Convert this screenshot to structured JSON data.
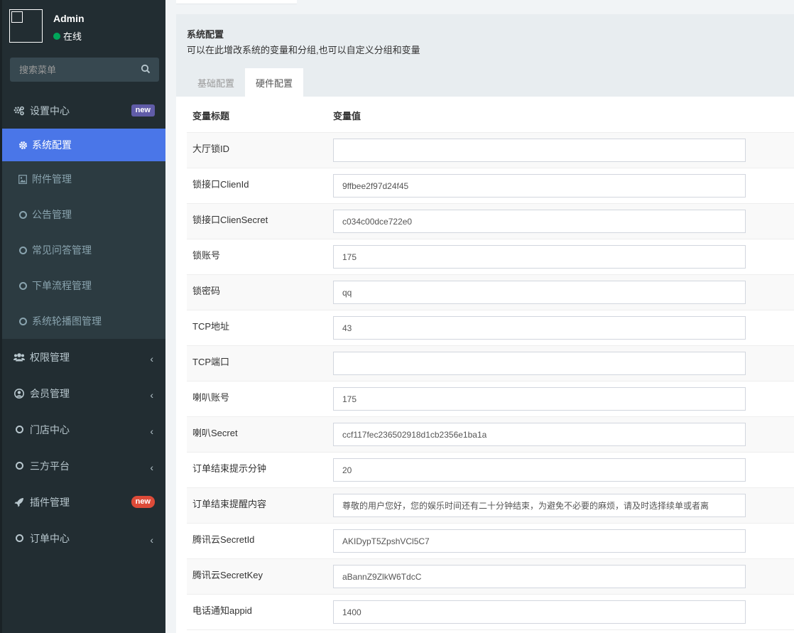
{
  "user": {
    "name": "Admin",
    "status": "在线"
  },
  "search": {
    "placeholder": "搜索菜单"
  },
  "menu": {
    "settings": {
      "label": "设置中心",
      "badge": "new"
    },
    "sub": [
      {
        "label": "系统配置",
        "icon": "gear-icon"
      },
      {
        "label": "附件管理",
        "icon": "image-icon"
      },
      {
        "label": "公告管理",
        "icon": "circle-icon"
      },
      {
        "label": "常见问答管理",
        "icon": "circle-icon"
      },
      {
        "label": "下单流程管理",
        "icon": "circle-icon"
      },
      {
        "label": "系统轮播图管理",
        "icon": "circle-icon"
      }
    ],
    "items": [
      {
        "label": "权限管理",
        "icon": "users-icon"
      },
      {
        "label": "会员管理",
        "icon": "user-circle-icon"
      },
      {
        "label": "门店中心",
        "icon": "circle-icon"
      },
      {
        "label": "三方平台",
        "icon": "circle-icon"
      },
      {
        "label": "插件管理",
        "icon": "rocket-icon",
        "badge": "new"
      },
      {
        "label": "订单中心",
        "icon": "circle-icon"
      }
    ]
  },
  "panel": {
    "title": "系统配置",
    "description": "可以在此增改系统的变量和分组,也可以自定义分组和变量",
    "tabs": [
      "基础配置",
      "硬件配置"
    ]
  },
  "table": {
    "headers": [
      "变量标题",
      "变量值"
    ],
    "rows": [
      {
        "label": "大厅锁ID",
        "value": ""
      },
      {
        "label": "锁接口ClienId",
        "value": "9ffbee2f97d24f45"
      },
      {
        "label": "锁接口ClienSecret",
        "value": "c034c00dce722e0"
      },
      {
        "label": "锁账号",
        "value": "175"
      },
      {
        "label": "锁密码",
        "value": "qq"
      },
      {
        "label": "TCP地址",
        "value": "43"
      },
      {
        "label": "TCP端口",
        "value": ""
      },
      {
        "label": "喇叭账号",
        "value": "175"
      },
      {
        "label": "喇叭Secret",
        "value": "ccf117fec236502918d1cb2356e1ba1a"
      },
      {
        "label": "订单结束提示分钟",
        "value": "20"
      },
      {
        "label": "订单结束提醒内容",
        "value": "尊敬的用户您好，您的娱乐时间还有二十分钟结束，为避免不必要的麻烦，请及时选择续单或者离"
      },
      {
        "label": "腾讯云SecretId",
        "value": "AKIDypT5ZpshVCl5C7"
      },
      {
        "label": "腾讯云SecretKey",
        "value": "aBannZ9ZlkW6TdcC"
      },
      {
        "label": "电话通知appid",
        "value": "1400"
      }
    ]
  },
  "colors": {
    "sidebar_bg": "#222d32",
    "active_item": "#4a76e8",
    "badge_purple": "#605ca8",
    "badge_red": "#dd4b39",
    "online": "#00a65a"
  }
}
